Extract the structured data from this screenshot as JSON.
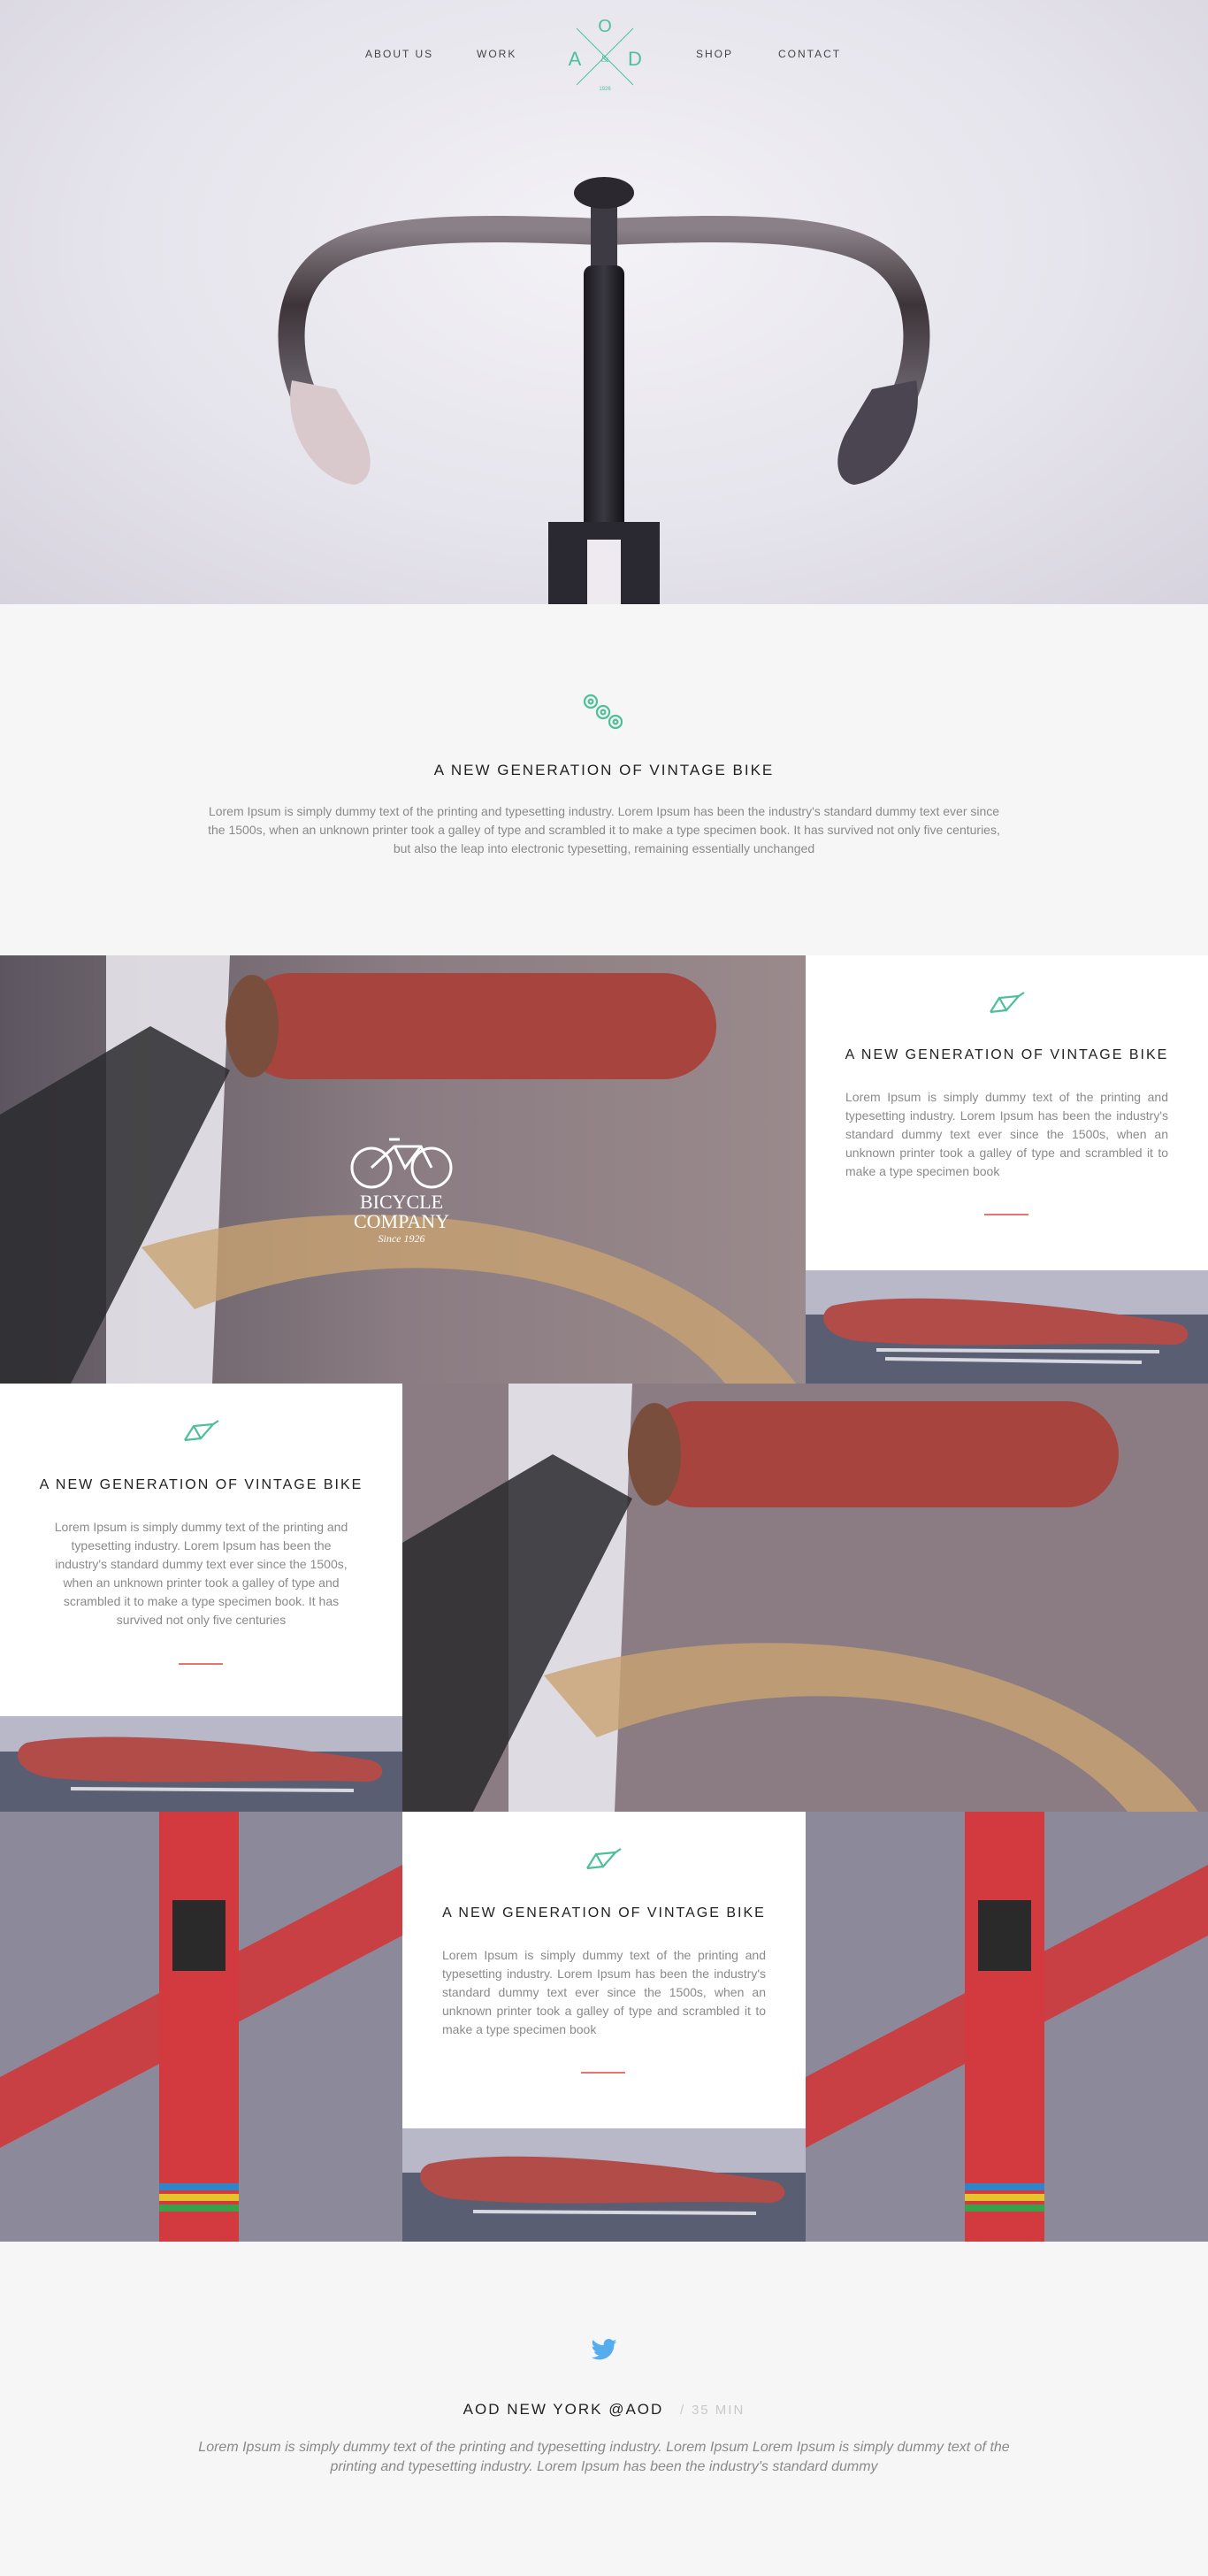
{
  "nav": {
    "left": [
      "ABOUT US",
      "WORK"
    ],
    "right": [
      "SHOP",
      "CONTACT"
    ],
    "logo": {
      "top": "O",
      "left": "A",
      "mid": "&",
      "right": "D",
      "bottom": "1926"
    }
  },
  "intro": {
    "icon": "bike-chain-icon",
    "title": "A NEW GENERATION OF VINTAGE BIKE",
    "text": "Lorem Ipsum is simply dummy text of the printing and typesetting industry. Lorem Ipsum has been the industry's standard dummy text ever since the 1500s, when an unknown printer took a galley of type and scrambled it to make a type specimen book. It has survived not only five centuries, but also the leap into electronic typesetting, remaining essentially unchanged"
  },
  "badge": {
    "line1": "BICYCLE",
    "line2": "COMPANY",
    "line3": "Since 1926"
  },
  "cards": [
    {
      "icon": "bike-frame-icon",
      "title": "A NEW GENERATION OF VINTAGE BIKE",
      "text": "Lorem Ipsum is simply dummy text of the printing and typesetting industry. Lorem Ipsum has been the industry's standard dummy text ever since the 1500s, when an unknown printer took a galley of type and scrambled it to make a type specimen book"
    },
    {
      "icon": "bike-frame-icon",
      "title": "A NEW GENERATION OF VINTAGE BIKE",
      "text": "Lorem Ipsum is simply dummy text of the printing and typesetting industry. Lorem Ipsum has been the industry's standard dummy text ever since the 1500s, when an unknown printer took a galley of type and scrambled it to make a type specimen book. It has survived not only five centuries"
    },
    {
      "icon": "bike-frame-icon",
      "title": "A NEW GENERATION OF VINTAGE BIKE",
      "text": "Lorem Ipsum is simply dummy text of the printing and typesetting industry. Lorem Ipsum has been the industry's standard dummy text ever since the 1500s, when an unknown printer took a galley of type and scrambled it to make a type specimen book"
    }
  ],
  "tweet": {
    "icon": "twitter-icon",
    "name": "AOD NEW YORK @AOD",
    "separator": "/",
    "time": "35 MIN",
    "text": "Lorem Ipsum is simply dummy text of the printing and typesetting industry. Lorem Ipsum Lorem Ipsum is simply dummy text of the printing and typesetting industry. Lorem Ipsum has been the industry's standard dummy"
  },
  "colors": {
    "accent_green": "#4dbf9a",
    "accent_red": "#e9746f",
    "twitter_blue": "#55acee"
  }
}
